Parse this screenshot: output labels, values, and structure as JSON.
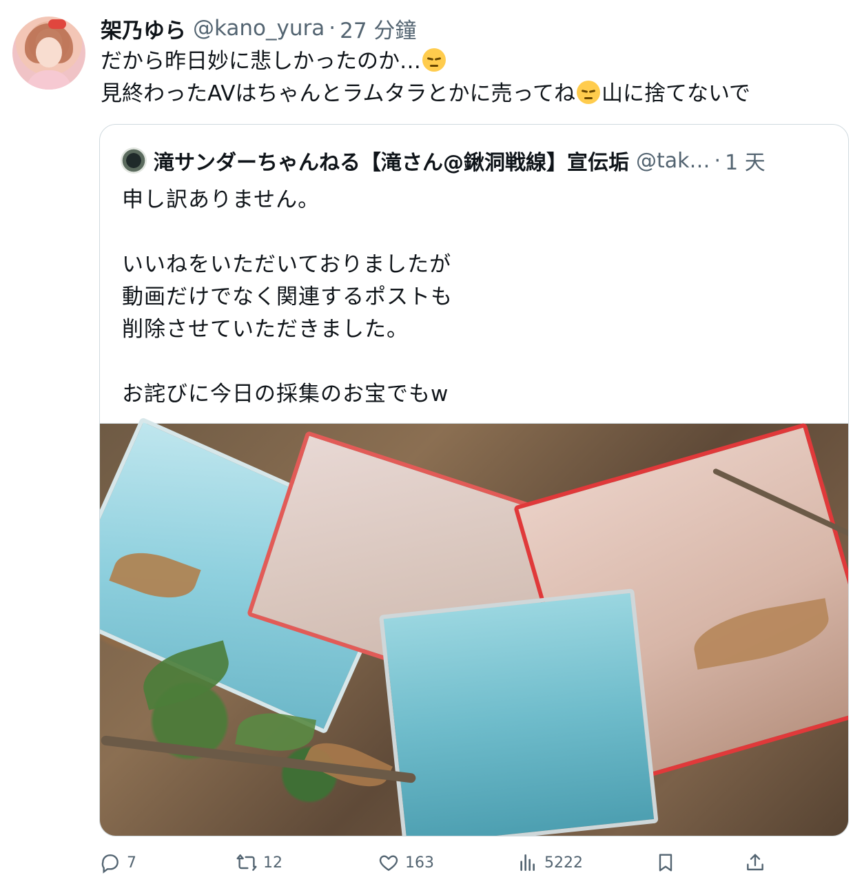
{
  "tweet": {
    "display_name": "架乃ゆら",
    "handle": "@kano_yura",
    "separator": "·",
    "time": "27 分鐘",
    "line1": "だから昨日妙に悲しかったのか…",
    "line2_a": "見終わったAVはちゃんとラムタラとかに売ってね",
    "line2_b": "山に捨てないで",
    "emoji_icon": "pensive-face-icon"
  },
  "quote": {
    "display_name": "滝サンダーちゃんねる【滝さん@鍬洞戦線】宣伝垢",
    "handle": "@tak…",
    "separator": "·",
    "time": "1 天",
    "text": "申し訳ありません。\n\nいいねをいただいておりましたが\n動画だけでなく関連するポストも\n削除させていただきました。\n\nお詫びに今日の採集のお宝でもw"
  },
  "actions": {
    "reply_count": "7",
    "retweet_count": "12",
    "like_count": "163",
    "views_count": "5222"
  },
  "colors": {
    "text_primary": "#0f1419",
    "text_secondary": "#536471",
    "border": "#cfd9de"
  }
}
